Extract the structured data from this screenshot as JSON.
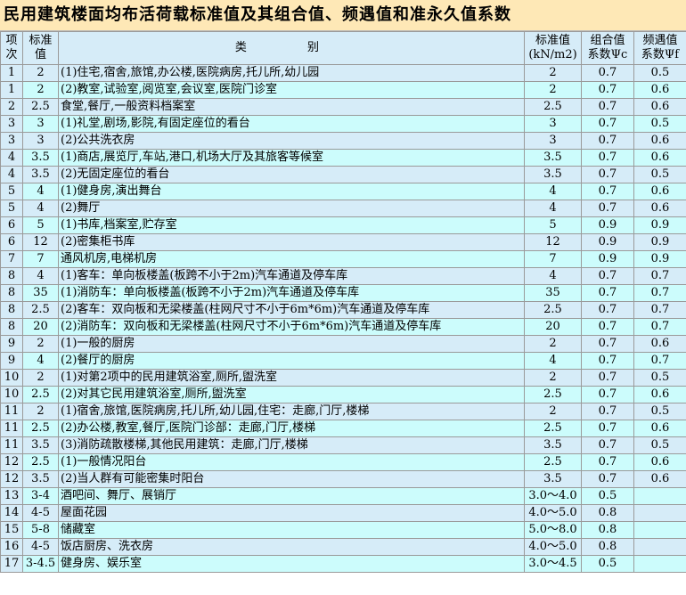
{
  "title": "民用建筑楼面均布活荷载标准值及其组合值、频遇值和准永久值系数",
  "headers": {
    "col1": [
      "项",
      "次"
    ],
    "col2": [
      "标准",
      "值"
    ],
    "col3": "类 别",
    "col4": [
      "标准值",
      "(kN/m2)"
    ],
    "col5": [
      "组合值",
      "系数Ψc"
    ],
    "col6": [
      "频遇值",
      "系数Ψf"
    ]
  },
  "rows": [
    {
      "n": "1",
      "v": "2",
      "desc": "(1)住宅,宿舍,旅馆,办公楼,医院病房,托儿所,幼儿园",
      "std": "2",
      "c": "0.7",
      "f": "0.5"
    },
    {
      "n": "1",
      "v": "2",
      "desc": "(2)教室,试验室,阅览室,会议室,医院门诊室",
      "std": "2",
      "c": "0.7",
      "f": "0.6"
    },
    {
      "n": "2",
      "v": "2.5",
      "desc": "食堂,餐厅,一般资料档案室",
      "std": "2.5",
      "c": "0.7",
      "f": "0.6"
    },
    {
      "n": "3",
      "v": "3",
      "desc": "(1)礼堂,剧场,影院,有固定座位的看台",
      "std": "3",
      "c": "0.7",
      "f": "0.5"
    },
    {
      "n": "3",
      "v": "3",
      "desc": "(2)公共洗衣房",
      "std": "3",
      "c": "0.7",
      "f": "0.6"
    },
    {
      "n": "4",
      "v": "3.5",
      "desc": "(1)商店,展览厅,车站,港口,机场大厅及其旅客等候室",
      "std": "3.5",
      "c": "0.7",
      "f": "0.6"
    },
    {
      "n": "4",
      "v": "3.5",
      "desc": "(2)无固定座位的看台",
      "std": "3.5",
      "c": "0.7",
      "f": "0.5"
    },
    {
      "n": "5",
      "v": "4",
      "desc": "(1)健身房,演出舞台",
      "std": "4",
      "c": "0.7",
      "f": "0.6"
    },
    {
      "n": "5",
      "v": "4",
      "desc": "(2)舞厅",
      "std": "4",
      "c": "0.7",
      "f": "0.6"
    },
    {
      "n": "6",
      "v": "5",
      "desc": "(1)书库,档案室,贮存室",
      "std": "5",
      "c": "0.9",
      "f": "0.9"
    },
    {
      "n": "6",
      "v": "12",
      "desc": "(2)密集柜书库",
      "std": "12",
      "c": "0.9",
      "f": "0.9"
    },
    {
      "n": "7",
      "v": "7",
      "desc": "通风机房,电梯机房",
      "std": "7",
      "c": "0.9",
      "f": "0.9"
    },
    {
      "n": "8",
      "v": "4",
      "desc": "(1)客车：单向板楼盖(板跨不小于2m)汽车通道及停车库",
      "std": "4",
      "c": "0.7",
      "f": "0.7"
    },
    {
      "n": "8",
      "v": "35",
      "desc": "(1)消防车：单向板楼盖(板跨不小于2m)汽车通道及停车库",
      "std": "35",
      "c": "0.7",
      "f": "0.7"
    },
    {
      "n": "8",
      "v": "2.5",
      "desc": "(2)客车：双向板和无梁楼盖(柱网尺寸不小于6m*6m)汽车通道及停车库",
      "std": "2.5",
      "c": "0.7",
      "f": "0.7"
    },
    {
      "n": "8",
      "v": "20",
      "desc": "(2)消防车：双向板和无梁楼盖(柱网尺寸不小于6m*6m)汽车通道及停车库",
      "std": "20",
      "c": "0.7",
      "f": "0.7"
    },
    {
      "n": "9",
      "v": "2",
      "desc": "(1)一般的厨房",
      "std": "2",
      "c": "0.7",
      "f": "0.6"
    },
    {
      "n": "9",
      "v": "4",
      "desc": "(2)餐厅的厨房",
      "std": "4",
      "c": "0.7",
      "f": "0.7"
    },
    {
      "n": "10",
      "v": "2",
      "desc": "(1)对第2项中的民用建筑浴室,厕所,盥洗室",
      "std": "2",
      "c": "0.7",
      "f": "0.5"
    },
    {
      "n": "10",
      "v": "2.5",
      "desc": "(2)对其它民用建筑浴室,厕所,盥洗室",
      "std": "2.5",
      "c": "0.7",
      "f": "0.6"
    },
    {
      "n": "11",
      "v": "2",
      "desc": "(1)宿舍,旅馆,医院病房,托儿所,幼儿园,住宅：走廊,门厅,楼梯",
      "std": "2",
      "c": "0.7",
      "f": "0.5"
    },
    {
      "n": "11",
      "v": "2.5",
      "desc": "(2)办公楼,教室,餐厅,医院门诊部：走廊,门厅,楼梯",
      "std": "2.5",
      "c": "0.7",
      "f": "0.6"
    },
    {
      "n": "11",
      "v": "3.5",
      "desc": "(3)消防疏散楼梯,其他民用建筑：走廊,门厅,楼梯",
      "std": "3.5",
      "c": "0.7",
      "f": "0.5"
    },
    {
      "n": "12",
      "v": "2.5",
      "desc": "(1)一般情况阳台",
      "std": "2.5",
      "c": "0.7",
      "f": "0.6"
    },
    {
      "n": "12",
      "v": "3.5",
      "desc": "(2)当人群有可能密集时阳台",
      "std": "3.5",
      "c": "0.7",
      "f": "0.6"
    },
    {
      "n": "13",
      "v": "3-4",
      "desc": "酒吧间、舞厅、展销厅",
      "std": "3.0～4.0",
      "c": "0.5",
      "f": ""
    },
    {
      "n": "14",
      "v": "4-5",
      "desc": "屋面花园",
      "std": "4.0～5.0",
      "c": "0.8",
      "f": ""
    },
    {
      "n": "15",
      "v": "5-8",
      "desc": "储藏室",
      "std": "5.0～8.0",
      "c": "0.8",
      "f": ""
    },
    {
      "n": "16",
      "v": "4-5",
      "desc": "饭店厨房、洗衣房",
      "std": "4.0～5.0",
      "c": "0.8",
      "f": ""
    },
    {
      "n": "17",
      "v": "3-4.5",
      "desc": "健身房、娱乐室",
      "std": "3.0～4.5",
      "c": "0.5",
      "f": ""
    }
  ]
}
